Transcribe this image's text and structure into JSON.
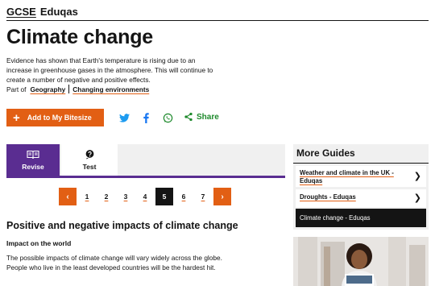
{
  "header": {
    "crumb_gcse": "GCSE",
    "crumb_board": "Eduqas"
  },
  "page": {
    "title": "Climate change",
    "summary": "Evidence has shown that Earth's temperature is rising due to an increase in greenhouse gases in the atmosphere. This will continue to create a number of negative and positive effects.",
    "part_of_label": "Part of",
    "part_of_links": [
      "Geography",
      "Changing environments"
    ]
  },
  "actions": {
    "add_label": "Add to My Bitesize",
    "share_label": "Share",
    "social_icons": [
      "twitter-icon",
      "facebook-icon",
      "whatsapp-icon",
      "share-icon"
    ]
  },
  "tabs": [
    {
      "label": "Revise",
      "icon": "book-icon",
      "active": true
    },
    {
      "label": "Test",
      "icon": "quiz-icon",
      "active": false
    }
  ],
  "pager": {
    "pages": [
      "1",
      "2",
      "3",
      "4",
      "5",
      "6",
      "7"
    ],
    "current": "5",
    "prev": "‹",
    "next": "›"
  },
  "content": {
    "section_heading": "Positive and negative impacts of climate change",
    "sub_heading": "Impact on the world",
    "paragraph": "The possible impacts of climate change will vary widely across the globe. People who live in the least developed countries will be the hardest hit."
  },
  "more_guides": {
    "heading": "More Guides",
    "items": [
      {
        "label": "Weather and climate in the UK - Eduqas",
        "current": false
      },
      {
        "label": "Droughts - Eduqas",
        "current": false
      },
      {
        "label": "Climate change - Eduqas",
        "current": true
      }
    ]
  },
  "colors": {
    "accent": "#e25f14",
    "purple": "#5a2d91",
    "share_green": "#1e8a2c",
    "dark": "#141414"
  }
}
